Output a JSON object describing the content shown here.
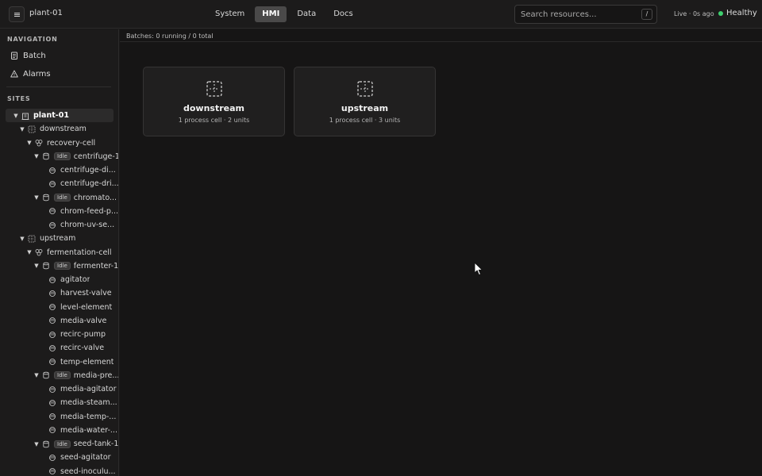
{
  "header": {
    "site_name": "plant-01",
    "tabs": [
      {
        "label": "System"
      },
      {
        "label": "HMI",
        "active": true
      },
      {
        "label": "Data"
      },
      {
        "label": "Docs"
      }
    ],
    "search_placeholder": "Search resources...",
    "search_shortcut": "/",
    "live_text": "Live · 0s ago",
    "health_text": "Healthy",
    "health_color": "#3ecf6e"
  },
  "sidebar": {
    "navigation_label": "NAVIGATION",
    "nav_items": [
      {
        "label": "Batch",
        "icon": "clipboard-icon"
      },
      {
        "label": "Alarms",
        "icon": "warning-icon"
      }
    ],
    "sites_label": "SITES",
    "tree": [
      {
        "label": "plant-01",
        "level": 0,
        "icon": "building-icon",
        "caret": true,
        "selected": true
      },
      {
        "label": "downstream",
        "level": 1,
        "icon": "grid-icon",
        "caret": true
      },
      {
        "label": "recovery-cell",
        "level": 2,
        "icon": "cell-icon",
        "caret": true
      },
      {
        "label": "centrifuge-1",
        "level": 3,
        "icon": "unit-icon",
        "caret": true,
        "badge": "Idle"
      },
      {
        "label": "centrifuge-di...",
        "level": 4,
        "icon": "module-icon"
      },
      {
        "label": "centrifuge-dri...",
        "level": 4,
        "icon": "module-icon"
      },
      {
        "label": "chromato...",
        "level": 3,
        "icon": "unit-icon",
        "caret": true,
        "badge": "Idle"
      },
      {
        "label": "chrom-feed-p...",
        "level": 4,
        "icon": "module-icon"
      },
      {
        "label": "chrom-uv-se...",
        "level": 4,
        "icon": "module-icon"
      },
      {
        "label": "upstream",
        "level": 1,
        "icon": "grid-icon",
        "caret": true
      },
      {
        "label": "fermentation-cell",
        "level": 2,
        "icon": "cell-icon",
        "caret": true
      },
      {
        "label": "fermenter-1",
        "level": 3,
        "icon": "unit-icon",
        "caret": true,
        "badge": "Idle"
      },
      {
        "label": "agitator",
        "level": 4,
        "icon": "module-icon"
      },
      {
        "label": "harvest-valve",
        "level": 4,
        "icon": "module-icon"
      },
      {
        "label": "level-element",
        "level": 4,
        "icon": "module-icon"
      },
      {
        "label": "media-valve",
        "level": 4,
        "icon": "module-icon"
      },
      {
        "label": "recirc-pump",
        "level": 4,
        "icon": "module-icon"
      },
      {
        "label": "recirc-valve",
        "level": 4,
        "icon": "module-icon"
      },
      {
        "label": "temp-element",
        "level": 4,
        "icon": "module-icon"
      },
      {
        "label": "media-pre...",
        "level": 3,
        "icon": "unit-icon",
        "caret": true,
        "badge": "Idle"
      },
      {
        "label": "media-agitator",
        "level": 4,
        "icon": "module-icon"
      },
      {
        "label": "media-steam...",
        "level": 4,
        "icon": "module-icon"
      },
      {
        "label": "media-temp-...",
        "level": 4,
        "icon": "module-icon"
      },
      {
        "label": "media-water-...",
        "level": 4,
        "icon": "module-icon"
      },
      {
        "label": "seed-tank-1",
        "level": 3,
        "icon": "unit-icon",
        "caret": true,
        "badge": "Idle"
      },
      {
        "label": "seed-agitator",
        "level": 4,
        "icon": "module-icon"
      },
      {
        "label": "seed-inoculu...",
        "level": 4,
        "icon": "module-icon"
      }
    ]
  },
  "main": {
    "batches_text": "Batches: 0 running / 0 total",
    "cards": [
      {
        "title": "downstream",
        "subtitle": "1 process cell · 2 units",
        "icon": "area-icon"
      },
      {
        "title": "upstream",
        "subtitle": "1 process cell · 3 units",
        "icon": "area-icon"
      }
    ]
  }
}
